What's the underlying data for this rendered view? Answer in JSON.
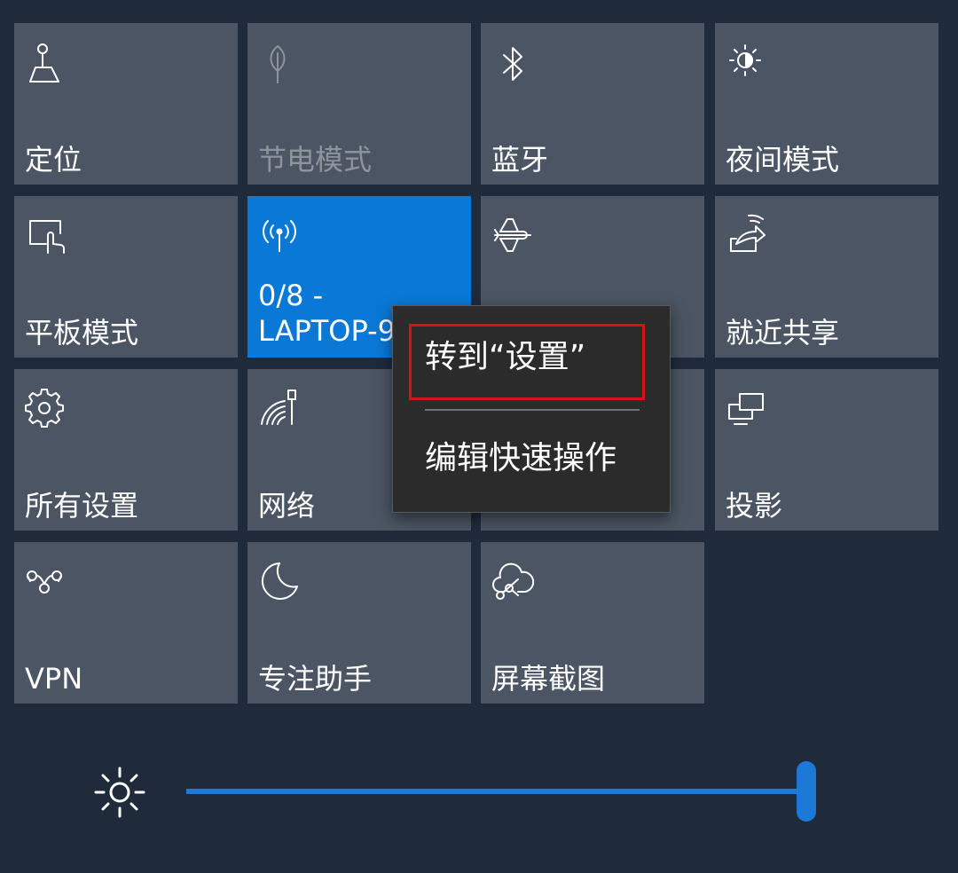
{
  "tiles": [
    {
      "label": "定位",
      "icon": "location-icon",
      "state": "normal"
    },
    {
      "label": "节电模式",
      "icon": "leaf-icon",
      "state": "disabled"
    },
    {
      "label": "蓝牙",
      "icon": "bluetooth-icon",
      "state": "normal"
    },
    {
      "label": "夜间模式",
      "icon": "night-light-icon",
      "state": "normal"
    },
    {
      "label": "平板模式",
      "icon": "tablet-mode-icon",
      "state": "normal"
    },
    {
      "label": "0/8 -\nLAPTOP-9",
      "icon": "mobile-hotspot-icon",
      "state": "active"
    },
    {
      "label": "",
      "icon": "airplane-icon",
      "state": "normal"
    },
    {
      "label": "就近共享",
      "icon": "nearby-share-icon",
      "state": "normal"
    },
    {
      "label": "所有设置",
      "icon": "gear-icon",
      "state": "normal"
    },
    {
      "label": "网络",
      "icon": "network-icon",
      "state": "normal"
    },
    {
      "label": "",
      "icon": "connect-icon",
      "state": "normal"
    },
    {
      "label": "投影",
      "icon": "project-icon",
      "state": "normal"
    },
    {
      "label": "VPN",
      "icon": "vpn-icon",
      "state": "normal"
    },
    {
      "label": "专注助手",
      "icon": "moon-icon",
      "state": "normal"
    },
    {
      "label": "屏幕截图",
      "icon": "snip-icon",
      "state": "normal"
    }
  ],
  "context_menu": {
    "items": [
      "转到“设置”",
      "编辑快速操作"
    ],
    "highlighted_item": 0,
    "highlight_color": "#d8121c"
  },
  "brightness": {
    "icon": "brightness-icon",
    "value_percent": 100,
    "accent_color": "#1c7ad6"
  },
  "colors": {
    "background": "#1f2a3b",
    "tile": "#4b5563",
    "tile_active": "#0a78d6",
    "menu_background": "#2b2b2b"
  }
}
